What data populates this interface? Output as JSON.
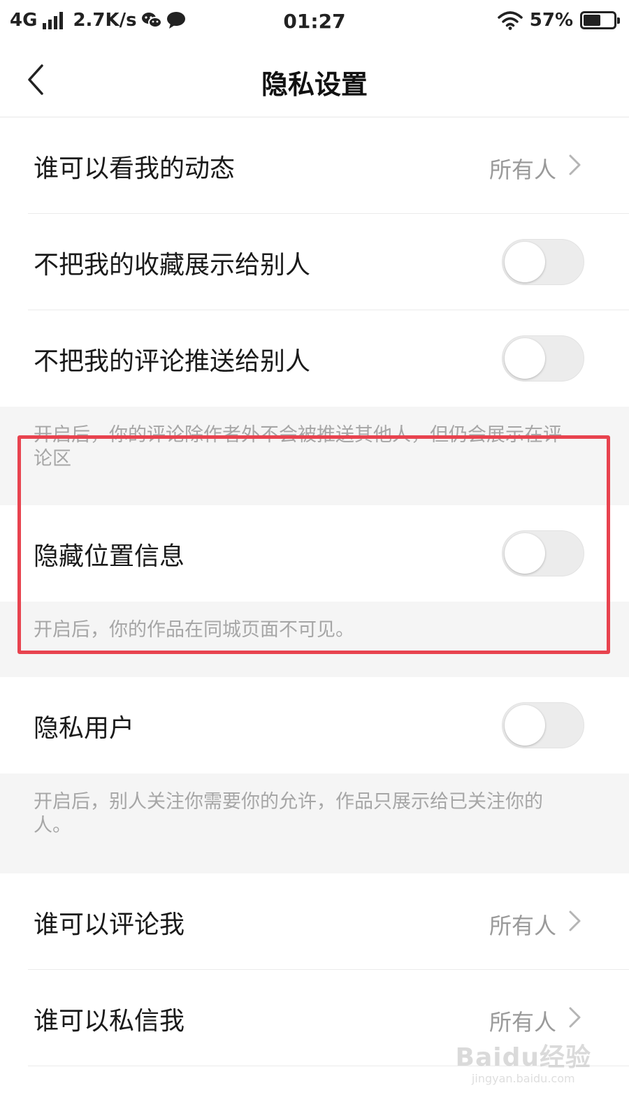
{
  "status_bar": {
    "network": "4G",
    "speed": "2.7K/s",
    "time": "01:27",
    "battery": "57%",
    "battery_level": 0.57
  },
  "header": {
    "title": "隐私设置"
  },
  "settings": {
    "who_can_see_activity": {
      "label": "谁可以看我的动态",
      "value": "所有人"
    },
    "hide_favorites": {
      "label": "不把我的收藏展示给别人",
      "on": false
    },
    "hide_comments": {
      "label": "不把我的评论推送给别人",
      "on": false,
      "note": "开启后，你的评论除作者外不会被推送其他人，但仍会展示在评论区"
    },
    "hide_location": {
      "label": "隐藏位置信息",
      "on": false,
      "note": "开启后，你的作品在同城页面不可见。"
    },
    "private_user": {
      "label": "隐私用户",
      "on": false,
      "note": "开启后，别人关注你需要你的允许，作品只展示给已关注你的人。"
    },
    "who_can_comment": {
      "label": "谁可以评论我",
      "value": "所有人"
    },
    "who_can_message": {
      "label": "谁可以私信我",
      "value": "所有人"
    }
  },
  "watermark": {
    "logo": "Baidu经验",
    "url": "jingyan.baidu.com"
  },
  "colors": {
    "highlight_border": "#e8434f",
    "toggle_off": "#ececec",
    "note_background": "#f5f5f5"
  },
  "icons": [
    "back-icon",
    "chevron-right-icon",
    "wifi-icon",
    "wechat-icon",
    "message-icon",
    "battery-icon",
    "signal-icon"
  ]
}
